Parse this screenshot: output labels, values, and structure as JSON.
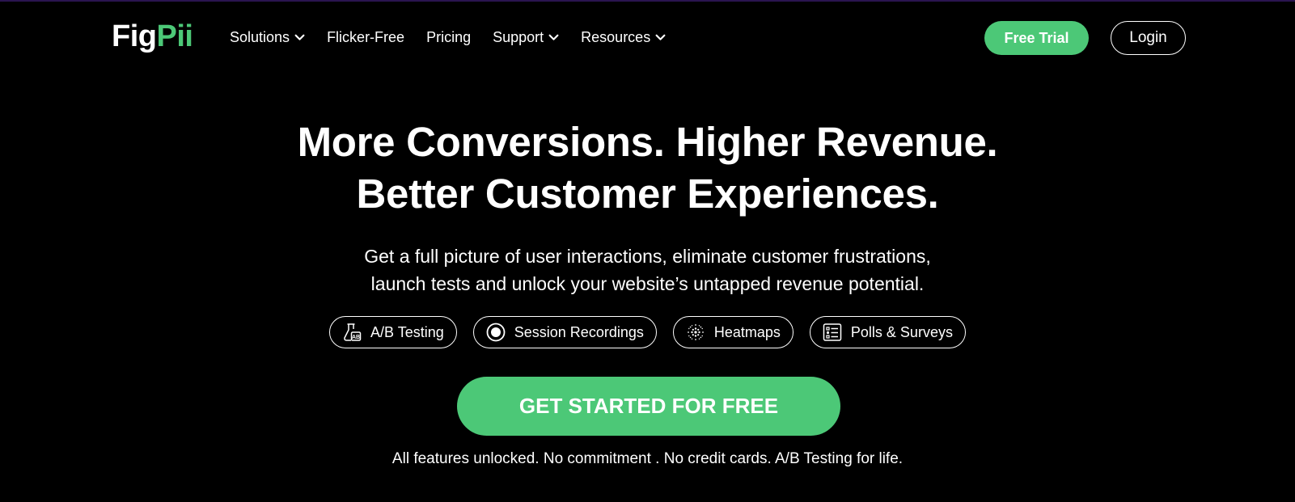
{
  "nav": {
    "logo_fig": "Fig",
    "logo_pii": "Pii",
    "items": [
      {
        "label": "Solutions",
        "has_dropdown": true
      },
      {
        "label": "Flicker-Free",
        "has_dropdown": false
      },
      {
        "label": "Pricing",
        "has_dropdown": false
      },
      {
        "label": "Support",
        "has_dropdown": true
      },
      {
        "label": "Resources",
        "has_dropdown": true
      }
    ],
    "free_trial_label": "Free Trial",
    "login_label": "Login"
  },
  "hero": {
    "headline_line1": "More Conversions. Higher Revenue.",
    "headline_line2": "Better Customer Experiences.",
    "subtext_line1": "Get a full picture of user interactions, eliminate customer frustrations,",
    "subtext_line2": "launch tests and unlock your website’s untapped revenue potential.",
    "features": [
      {
        "label": "A/B Testing",
        "icon": "flask-ab-icon"
      },
      {
        "label": "Session Recordings",
        "icon": "record-icon"
      },
      {
        "label": "Heatmaps",
        "icon": "heatmap-icon"
      },
      {
        "label": "Polls & Surveys",
        "icon": "survey-icon"
      }
    ],
    "cta_label": "GET STARTED FOR FREE",
    "note": "All features unlocked. No commitment . No credit cards. A/B Testing for life."
  },
  "colors": {
    "accent": "#4cc877",
    "background": "#000000",
    "text": "#ffffff"
  }
}
